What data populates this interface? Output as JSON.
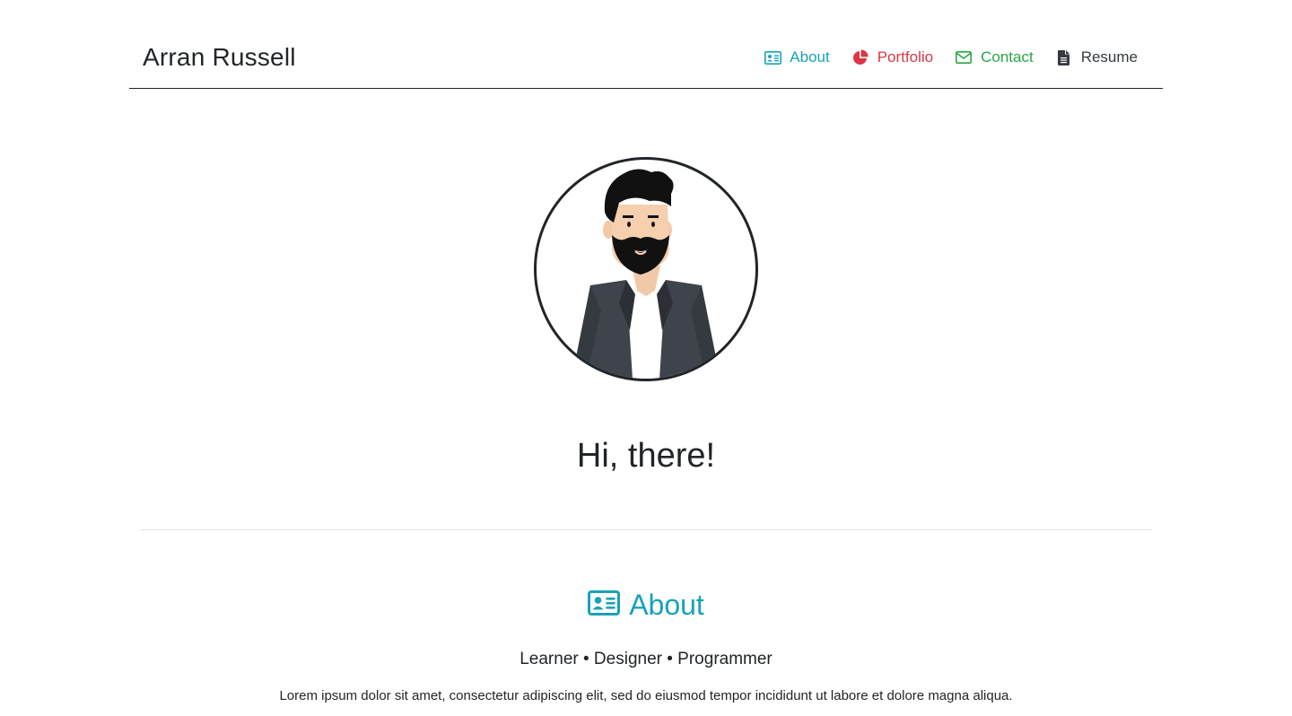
{
  "header": {
    "brand": "Arran Russell",
    "nav": [
      {
        "label": "About",
        "icon": "id-card-icon",
        "color": "#17a2b8"
      },
      {
        "label": "Portfolio",
        "icon": "pie-chart-icon",
        "color": "#dc3545"
      },
      {
        "label": "Contact",
        "icon": "envelope-icon",
        "color": "#28a745"
      },
      {
        "label": "Resume",
        "icon": "file-icon",
        "color": "#343a40"
      }
    ]
  },
  "hero": {
    "avatar": "bearded-man-avatar-illustration",
    "title": "Hi, there!"
  },
  "about": {
    "heading": "About",
    "icon": "id-card-icon",
    "tagline": "Learner • Designer • Programmer",
    "text": "Lorem ipsum dolor sit amet, consectetur adipiscing elit, sed do eiusmod tempor incididunt ut labore et dolore magna aliqua."
  },
  "colors": {
    "accent_about": "#17a2b8",
    "accent_portfolio": "#dc3545",
    "accent_contact": "#28a745",
    "text_dark": "#212529"
  }
}
